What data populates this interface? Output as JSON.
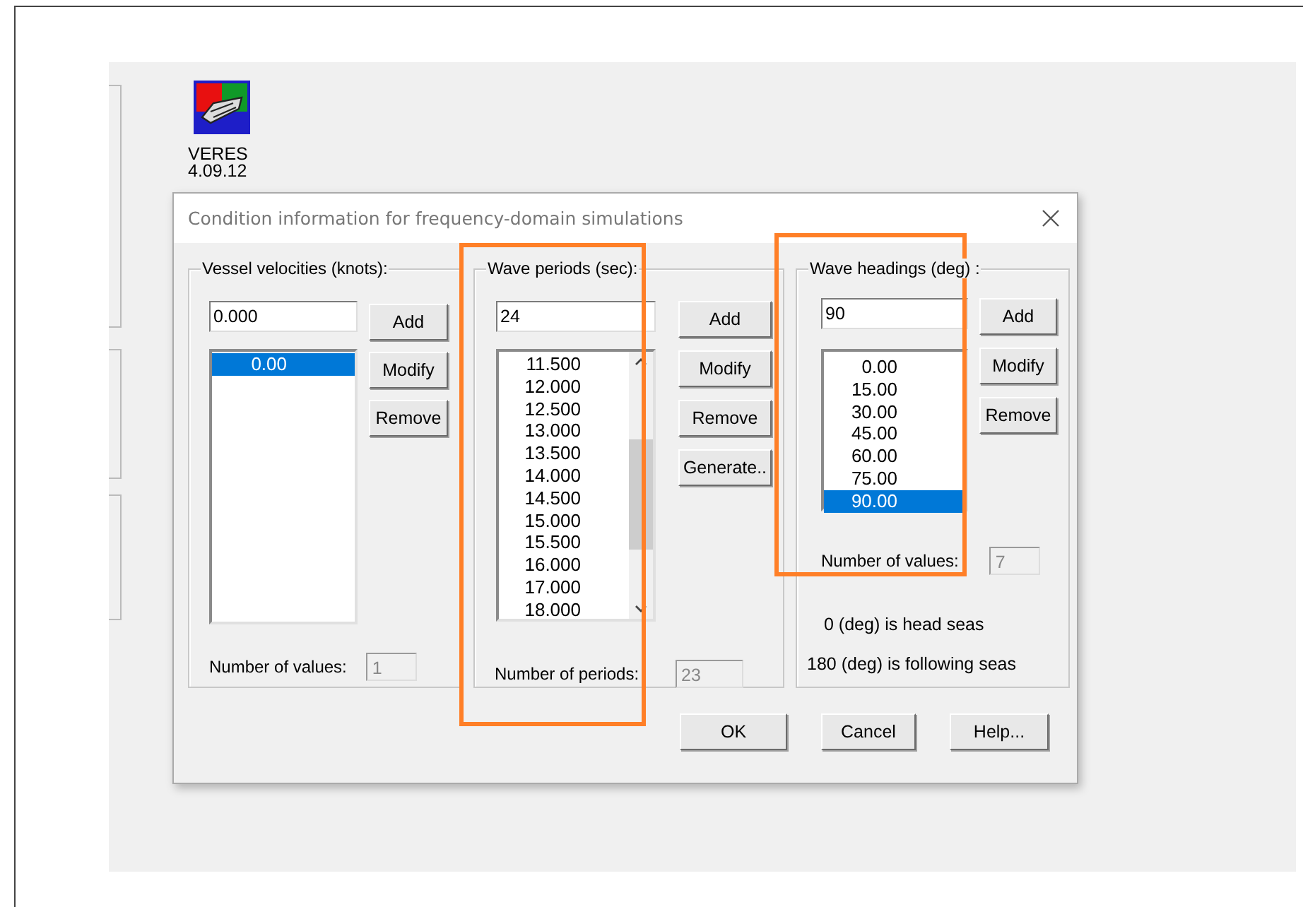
{
  "desktop_icon": {
    "label_lines": [
      "VERES",
      "4.09.12"
    ]
  },
  "dialog": {
    "title": "Condition information for frequency-domain simulations",
    "groups": [
      {
        "kind": "velocities",
        "title": "Vessel velocities (knots):",
        "input": "0.000",
        "highlighted": false,
        "scrollbar": false,
        "items": [
          {
            "label": "0.00",
            "selected": true
          }
        ],
        "buttons": [
          "Add",
          "Modify",
          "Remove"
        ],
        "count_label": "Number of values:",
        "count": "1"
      },
      {
        "kind": "periods",
        "title": "Wave periods (sec):",
        "input": "24",
        "highlighted": true,
        "scrollbar": true,
        "items": [
          {
            "label": "11.500",
            "selected": false
          },
          {
            "label": "12.000",
            "selected": false
          },
          {
            "label": "12.500",
            "selected": false
          },
          {
            "label": "13.000",
            "selected": false
          },
          {
            "label": "13.500",
            "selected": false
          },
          {
            "label": "14.000",
            "selected": false
          },
          {
            "label": "14.500",
            "selected": false
          },
          {
            "label": "15.000",
            "selected": false
          },
          {
            "label": "15.500",
            "selected": false
          },
          {
            "label": "16.000",
            "selected": false
          },
          {
            "label": "17.000",
            "selected": false
          },
          {
            "label": "18.000",
            "selected": false
          }
        ],
        "buttons": [
          "Add",
          "Modify",
          "Remove",
          "Generate.."
        ],
        "count_label": "Number of periods:",
        "count": "23"
      },
      {
        "kind": "headings",
        "title": "Wave headings (deg) :",
        "input": "90",
        "highlighted": true,
        "scrollbar": false,
        "items": [
          {
            "label": "0.00",
            "selected": false
          },
          {
            "label": "15.00",
            "selected": false
          },
          {
            "label": "30.00",
            "selected": false
          },
          {
            "label": "45.00",
            "selected": false
          },
          {
            "label": "60.00",
            "selected": false
          },
          {
            "label": "75.00",
            "selected": false
          },
          {
            "label": "90.00",
            "selected": true
          }
        ],
        "buttons": [
          "Add",
          "Modify",
          "Remove"
        ],
        "count_label": "Number of values:",
        "count": "7",
        "notes": [
          "0  (deg)  is head seas",
          "180  (deg)  is following seas"
        ]
      }
    ],
    "buttons": [
      "OK",
      "Cancel",
      "Help..."
    ]
  }
}
